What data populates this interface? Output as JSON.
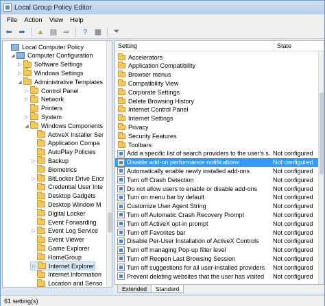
{
  "window": {
    "title": "Local Group Policy Editor"
  },
  "menu": [
    "File",
    "Action",
    "View",
    "Help"
  ],
  "toolbar": {
    "icons": [
      "back-arrow-icon",
      "forward-arrow-icon",
      "up-folder-icon",
      "show-hide-tree-icon",
      "export-list-icon",
      "help-icon",
      "properties-icon",
      "filter-icon"
    ]
  },
  "tree": {
    "nodes": [
      {
        "label": "Local Computer Policy",
        "icon": "policy",
        "expander": ""
      },
      {
        "label": "Computer Configuration",
        "icon": "computer",
        "expander": "◢"
      },
      {
        "label": "Software Settings",
        "icon": "folder",
        "expander": "▷"
      },
      {
        "label": "Windows Settings",
        "icon": "folder",
        "expander": "▷"
      },
      {
        "label": "Administrative Templates",
        "icon": "folder",
        "expander": "◢"
      },
      {
        "label": "Control Panel",
        "icon": "folder",
        "expander": "▷"
      },
      {
        "label": "Network",
        "icon": "folder",
        "expander": "▷"
      },
      {
        "label": "Printers",
        "icon": "folder",
        "expander": ""
      },
      {
        "label": "System",
        "icon": "folder",
        "expander": "▷"
      },
      {
        "label": "Windows Components",
        "icon": "folder",
        "expander": "◢"
      },
      {
        "label": "ActiveX Installer Ser",
        "icon": "folder",
        "expander": ""
      },
      {
        "label": "Application Compa",
        "icon": "folder",
        "expander": ""
      },
      {
        "label": "AutoPlay Policies",
        "icon": "folder",
        "expander": ""
      },
      {
        "label": "Backup",
        "icon": "folder",
        "expander": "▷"
      },
      {
        "label": "Biometrics",
        "icon": "folder",
        "expander": ""
      },
      {
        "label": "BitLocker Drive Encr",
        "icon": "folder",
        "expander": "▷"
      },
      {
        "label": "Credential User Inte",
        "icon": "folder",
        "expander": ""
      },
      {
        "label": "Desktop Gadgets",
        "icon": "folder",
        "expander": ""
      },
      {
        "label": "Desktop Window M",
        "icon": "folder",
        "expander": ""
      },
      {
        "label": "Digital Locker",
        "icon": "folder",
        "expander": ""
      },
      {
        "label": "Event Forwarding",
        "icon": "folder",
        "expander": ""
      },
      {
        "label": "Event Log Service",
        "icon": "folder",
        "expander": "▷"
      },
      {
        "label": "Event Viewer",
        "icon": "folder",
        "expander": ""
      },
      {
        "label": "Game Explorer",
        "icon": "folder",
        "expander": ""
      },
      {
        "label": "HomeGroup",
        "icon": "folder",
        "expander": ""
      },
      {
        "label": "Internet Explorer",
        "icon": "folder",
        "expander": "▷"
      },
      {
        "label": "Internet Information",
        "icon": "folder",
        "expander": ""
      },
      {
        "label": "Location and Senso",
        "icon": "folder",
        "expander": ""
      }
    ]
  },
  "list": {
    "headers": {
      "setting": "Setting",
      "state": "State"
    },
    "rows": [
      {
        "name": "Accelerators",
        "state": "",
        "type": "folder"
      },
      {
        "name": "Application Compatibility",
        "state": "",
        "type": "folder"
      },
      {
        "name": "Browser menus",
        "state": "",
        "type": "folder"
      },
      {
        "name": "Compatibility View",
        "state": "",
        "type": "folder"
      },
      {
        "name": "Corporate Settings",
        "state": "",
        "type": "folder"
      },
      {
        "name": "Delete Browsing History",
        "state": "",
        "type": "folder"
      },
      {
        "name": "Internet Control Panel",
        "state": "",
        "type": "folder"
      },
      {
        "name": "Internet Settings",
        "state": "",
        "type": "folder"
      },
      {
        "name": "Privacy",
        "state": "",
        "type": "folder"
      },
      {
        "name": "Security Features",
        "state": "",
        "type": "folder"
      },
      {
        "name": "Toolbars",
        "state": "",
        "type": "folder"
      },
      {
        "name": "Add a specific list of search providers to the user's s...",
        "state": "Not configured",
        "type": "policy"
      },
      {
        "name": "Disable add-on performance notifications",
        "state": "Not configured",
        "type": "policy"
      },
      {
        "name": "Automatically enable newly installed add-ons",
        "state": "Not configured",
        "type": "policy"
      },
      {
        "name": "Turn off Crash Detection",
        "state": "Not configured",
        "type": "policy"
      },
      {
        "name": "Do not allow users to enable or disable add-ons",
        "state": "Not configured",
        "type": "policy"
      },
      {
        "name": "Turn on menu bar by default",
        "state": "Not configured",
        "type": "policy"
      },
      {
        "name": "Customize User Agent String",
        "state": "Not configured",
        "type": "policy"
      },
      {
        "name": "Turn off Automatic Crash Recovery Prompt",
        "state": "Not configured",
        "type": "policy"
      },
      {
        "name": "Turn off ActiveX opt-in prompt",
        "state": "Not configured",
        "type": "policy"
      },
      {
        "name": "Turn off Favorites bar",
        "state": "Not configured",
        "type": "policy"
      },
      {
        "name": "Disable Per-User Installation of ActiveX Controls",
        "state": "Not configured",
        "type": "policy"
      },
      {
        "name": "Turn off managing Pop-up filter level",
        "state": "Not configured",
        "type": "policy"
      },
      {
        "name": "Turn off Reopen Last Browsing Session",
        "state": "Not configured",
        "type": "policy"
      },
      {
        "name": "Turn off suggestions for all user-installed providers",
        "state": "Not configured",
        "type": "policy"
      },
      {
        "name": "Prevent deleting websites that the user has visited",
        "state": "Not configured",
        "type": "policy"
      }
    ],
    "selected_index": 12
  },
  "tabs": [
    "Extended",
    "Standard"
  ],
  "active_tab": 1,
  "status": {
    "text": "61 setting(s)"
  },
  "colors": {
    "selection": "#3399ff",
    "folder": "#f2c95a"
  }
}
